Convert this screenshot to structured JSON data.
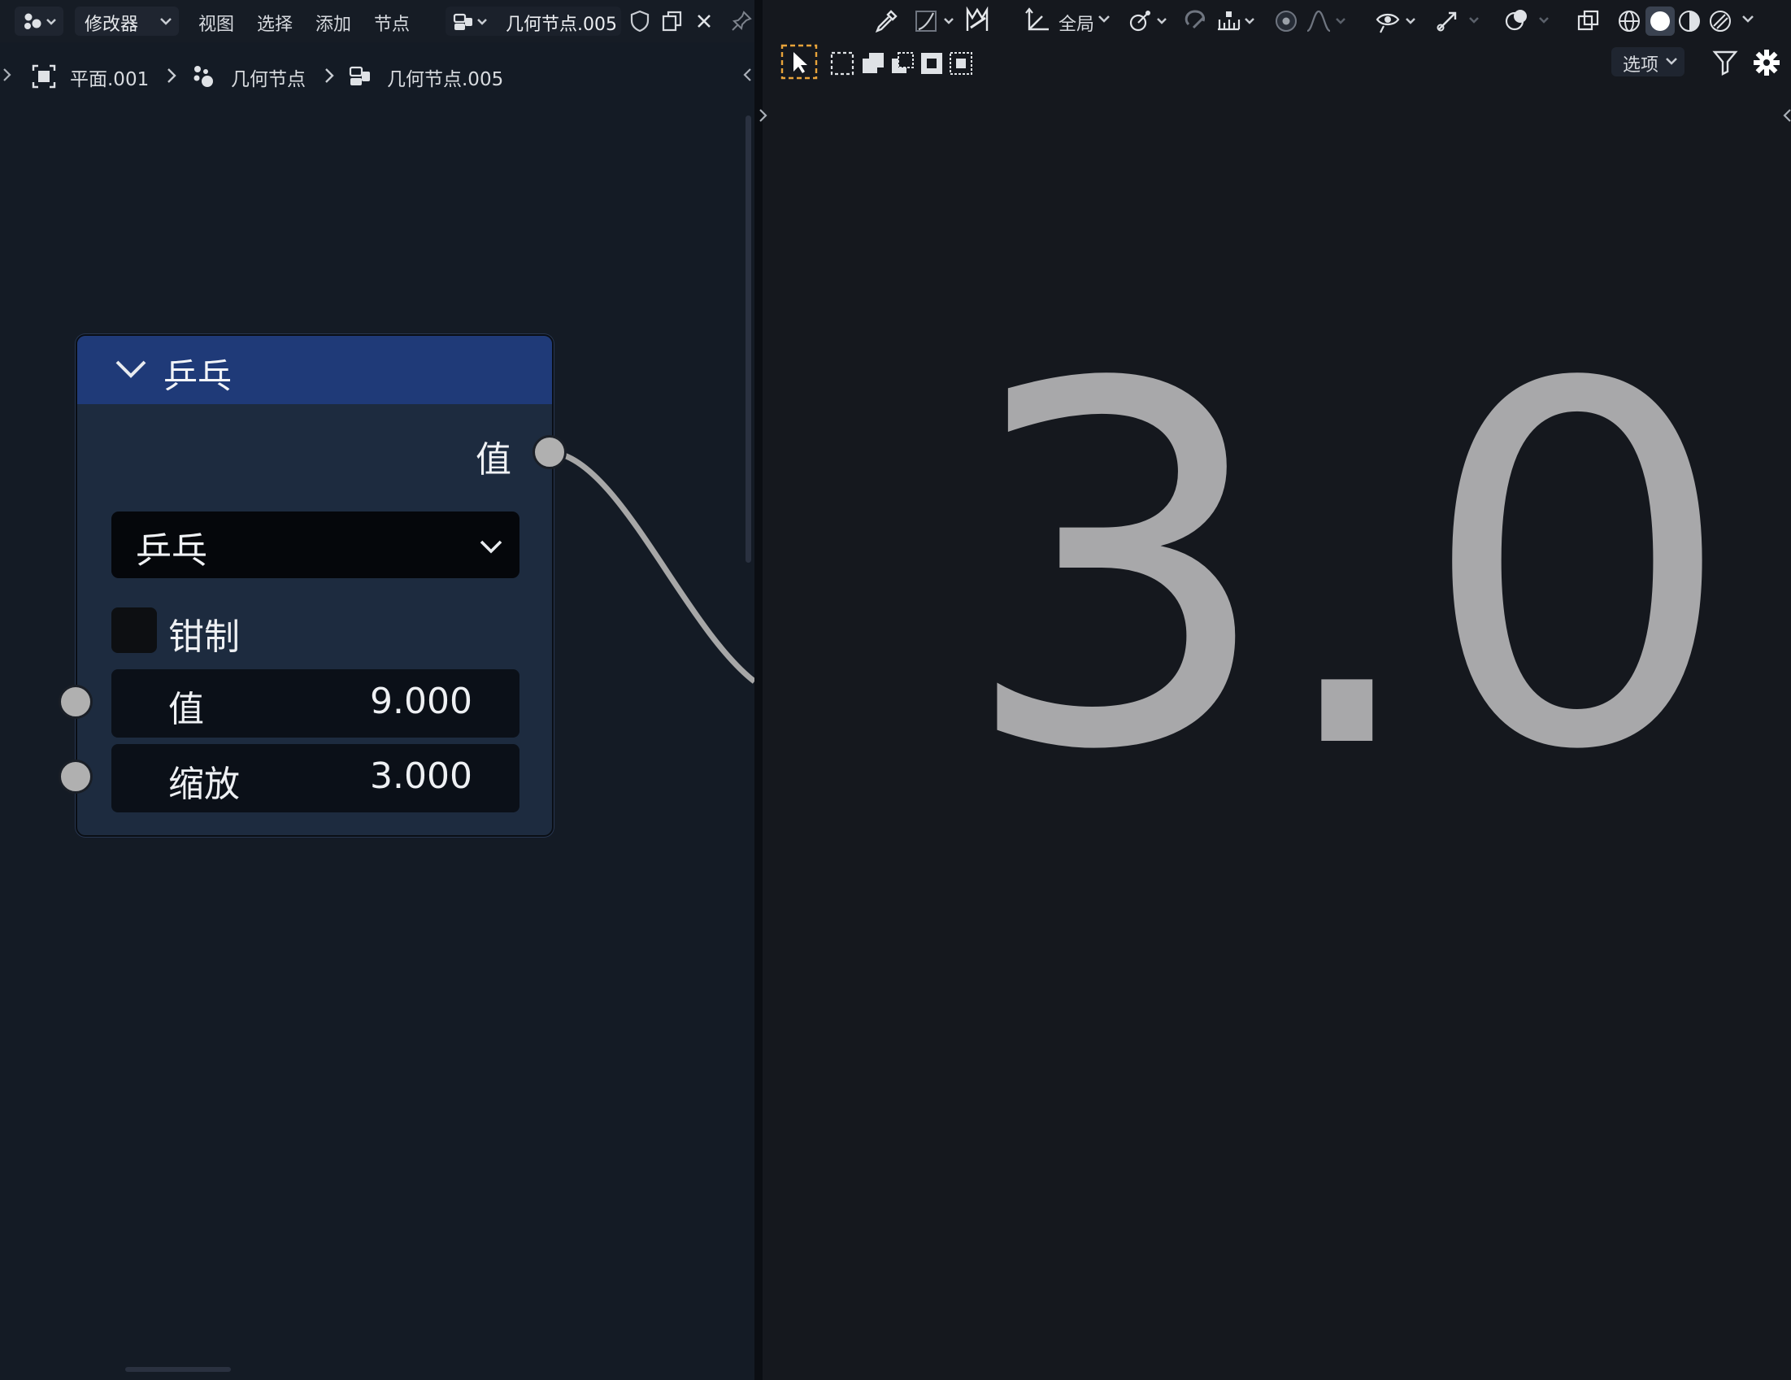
{
  "node_editor": {
    "header": {
      "modifier_dropdown": "修改器",
      "menus": [
        "视图",
        "选择",
        "添加",
        "节点"
      ],
      "node_group_name": "几何节点.005"
    },
    "breadcrumb": {
      "object": "平面.001",
      "modifier": "几何节点",
      "node_group": "几何节点.005"
    },
    "node": {
      "title": "乒乓",
      "output_label": "值",
      "operation": "乒乓",
      "clamp_label": "钳制",
      "clamp_checked": false,
      "fields": [
        {
          "name": "值",
          "value": "9.000"
        },
        {
          "name": "缩放",
          "value": "3.000"
        }
      ]
    }
  },
  "viewer": {
    "value_display": "3.0",
    "transform_orientation": "全局",
    "options_label": "选项"
  },
  "colors": {
    "node_header": "#1f3a78",
    "node_body": "#1d2b3f",
    "socket": "#b0b0b0",
    "select_accent": "#e8a33a",
    "big_value_text": "#a8a8aa"
  }
}
